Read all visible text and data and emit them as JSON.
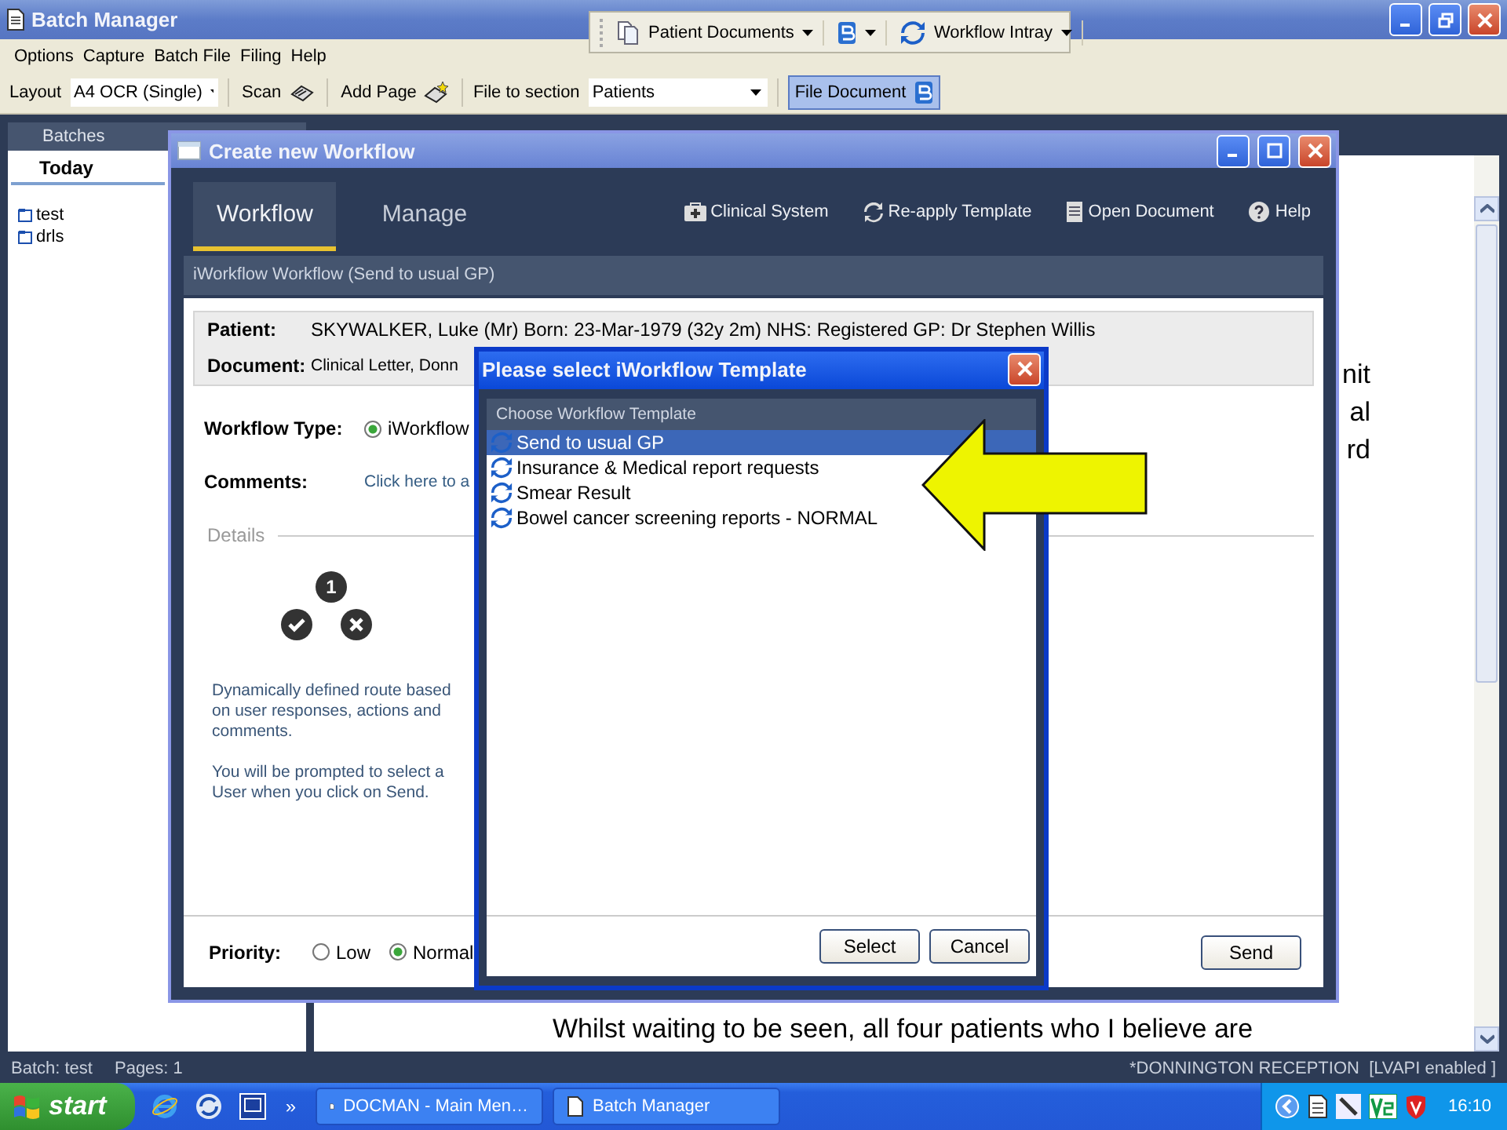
{
  "window": {
    "title": "Batch Manager"
  },
  "quick_toolbar": [
    {
      "kind": "documents",
      "label": "Patient Documents"
    },
    {
      "kind": "app"
    },
    {
      "kind": "intray",
      "label": "Workflow Intray"
    }
  ],
  "menu": [
    "Options",
    "Capture",
    "Batch File",
    "Filing",
    "Help"
  ],
  "toolbar": {
    "layout_label": "Layout",
    "layout_value": "A4 OCR (Single)",
    "scan": "Scan",
    "add_page": "Add Page",
    "section_label": "File to section",
    "section_value": "Patients",
    "file_document": "File Document"
  },
  "batches": {
    "header": "Batches",
    "tab": "Today",
    "items": [
      "test",
      "drls"
    ]
  },
  "document": {
    "fragments": [
      "nit",
      "al",
      "rd"
    ],
    "footer_line": "Whilst waiting to be seen, all four patients who I believe are"
  },
  "status_bar": {
    "batch": "Batch: test",
    "pages": "Pages: 1",
    "location": "*DONNINGTON RECEPTION  [LVAPI enabled ]"
  },
  "workflow_dialog": {
    "title": "Create new Workflow",
    "tabs": [
      {
        "label": "Workflow",
        "selected": true
      },
      {
        "label": "Manage",
        "selected": false
      }
    ],
    "actions": [
      {
        "kind": "clinical",
        "label": "Clinical System"
      },
      {
        "kind": "reapply",
        "label": "Re-apply Template"
      },
      {
        "kind": "document",
        "label": "Open Document"
      },
      {
        "kind": "help",
        "label": "Help"
      }
    ],
    "section_title": "iWorkflow Workflow (Send to usual GP)",
    "patient_label": "Patient:",
    "patient_value": "SKYWALKER, Luke (Mr)  Born: 23-Mar-1979 (32y 2m)  NHS:   Registered GP: Dr Stephen Willis",
    "document_label": "Document:",
    "document_value": "Clinical Letter, Donn",
    "workflow_type_label": "Workflow Type:",
    "workflow_type_option": {
      "label": "iWorkflow",
      "selected": true
    },
    "comments_label": "Comments:",
    "comments_placeholder": "Click here to a",
    "details_legend": "Details",
    "route_step": "1",
    "description": [
      "Dynamically defined route based on user responses, actions and comments.",
      "You will be prompted to select a User when you click on Send."
    ],
    "priority_label": "Priority:",
    "priority_options": [
      {
        "label": "Low",
        "selected": false
      },
      {
        "label": "Normal",
        "selected": true
      }
    ],
    "send": "Send"
  },
  "template_dialog": {
    "title": "Please select iWorkflow Template",
    "header": "Choose Workflow Template",
    "templates": [
      {
        "label": "Send to usual GP",
        "selected": true
      },
      {
        "label": "Insurance & Medical report requests",
        "selected": false
      },
      {
        "label": "Smear Result",
        "selected": false
      },
      {
        "label": "Bowel cancer screening reports - NORMAL",
        "selected": false
      }
    ],
    "buttons": [
      "Select",
      "Cancel"
    ]
  },
  "taskbar": {
    "start": "start",
    "overflow": "»",
    "tasks": [
      "DOCMAN - Main Men…",
      "Batch Manager"
    ],
    "clock": "16:10"
  }
}
